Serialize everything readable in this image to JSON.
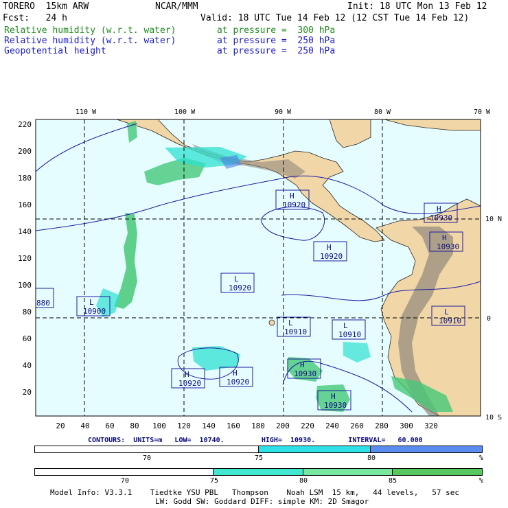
{
  "header": {
    "model": "TORERO  15km ARW",
    "center": "NCAR/MMM",
    "init": "Init: 18 UTC Mon 13 Feb 12",
    "fcst": "Fcst:   24 h",
    "valid": "Valid: 18 UTC Tue 14 Feb 12 (12 CST Tue 14 Feb 12)",
    "fields": [
      {
        "name": "Relative humidity (w.r.t. water)",
        "level": "at pressure =  300 hPa",
        "color": "#1f8a1f"
      },
      {
        "name": "Relative humidity (w.r.t. water)",
        "level": "at pressure =  250 hPa",
        "color": "#1a1acc"
      },
      {
        "name": "Geopotential height",
        "level": "at pressure =  250 hPa",
        "color": "#1a1acc"
      }
    ]
  },
  "map": {
    "lon_labels": [
      "110 W",
      "100 W",
      "90 W",
      "80 W",
      "70 W"
    ],
    "lat_labels": [
      "10 N",
      "0",
      "10 S"
    ],
    "x_ticks": [
      "20",
      "40",
      "60",
      "80",
      "100",
      "120",
      "140",
      "160",
      "180",
      "200",
      "220",
      "240",
      "260",
      "280",
      "300",
      "320"
    ],
    "y_ticks": [
      "220",
      "200",
      "180",
      "160",
      "140",
      "120",
      "100",
      "80",
      "60",
      "40",
      "20"
    ],
    "pressure_centers": [
      {
        "type": "H",
        "value": "10920"
      },
      {
        "type": "H",
        "value": "10930"
      },
      {
        "type": "H",
        "value": "10930"
      },
      {
        "type": "H",
        "value": "10920"
      },
      {
        "type": "L",
        "value": "10920"
      },
      {
        "type": "L",
        "value": "10900"
      },
      {
        "type": "",
        "value": "880"
      },
      {
        "type": "L",
        "value": "10910"
      },
      {
        "type": "L",
        "value": "10910"
      },
      {
        "type": "L",
        "value": "10910"
      },
      {
        "type": "H",
        "value": "10920"
      },
      {
        "type": "H",
        "value": "10920"
      },
      {
        "type": "H",
        "value": "10930"
      },
      {
        "type": "H",
        "value": "10930"
      }
    ],
    "colors": {
      "ocean": "#e6fdff",
      "land": "#f1d7a8",
      "mountain": "#8a8277",
      "rh_green": "#45c878",
      "rh_cyan": "#2ee0d0",
      "rh_blue": "#4f7fe8",
      "contour": "#1a1aa0"
    }
  },
  "contours_line": "CONTOURS:  UNITS=m   LOW=  10740.         HIGH=  10930.        INTERVAL=   60.000",
  "scale1": {
    "labels": [
      "70",
      "75",
      "80",
      "%"
    ],
    "segments": [
      {
        "color": "#ffffff",
        "fraction": 0.5
      },
      {
        "color": "#2ee0e8",
        "fraction": 0.25
      },
      {
        "color": "#5b8df0",
        "fraction": 0.25
      }
    ]
  },
  "scale2": {
    "labels": [
      "70",
      "75",
      "80",
      "85",
      "%"
    ],
    "segments": [
      {
        "color": "#ffffff",
        "fraction": 0.4
      },
      {
        "color": "#40e8d0",
        "fraction": 0.2
      },
      {
        "color": "#78e8a0",
        "fraction": 0.2
      },
      {
        "color": "#55c860",
        "fraction": 0.2
      }
    ]
  },
  "footer": {
    "line1": "Model Info: V3.3.1    Tiedtke YSU PBL   Thompson    Noah LSM  15 km,   44 levels,   57 sec",
    "line2": "LW: Godd SW: Goddard DIFF: simple KM: 2D Smagor"
  }
}
